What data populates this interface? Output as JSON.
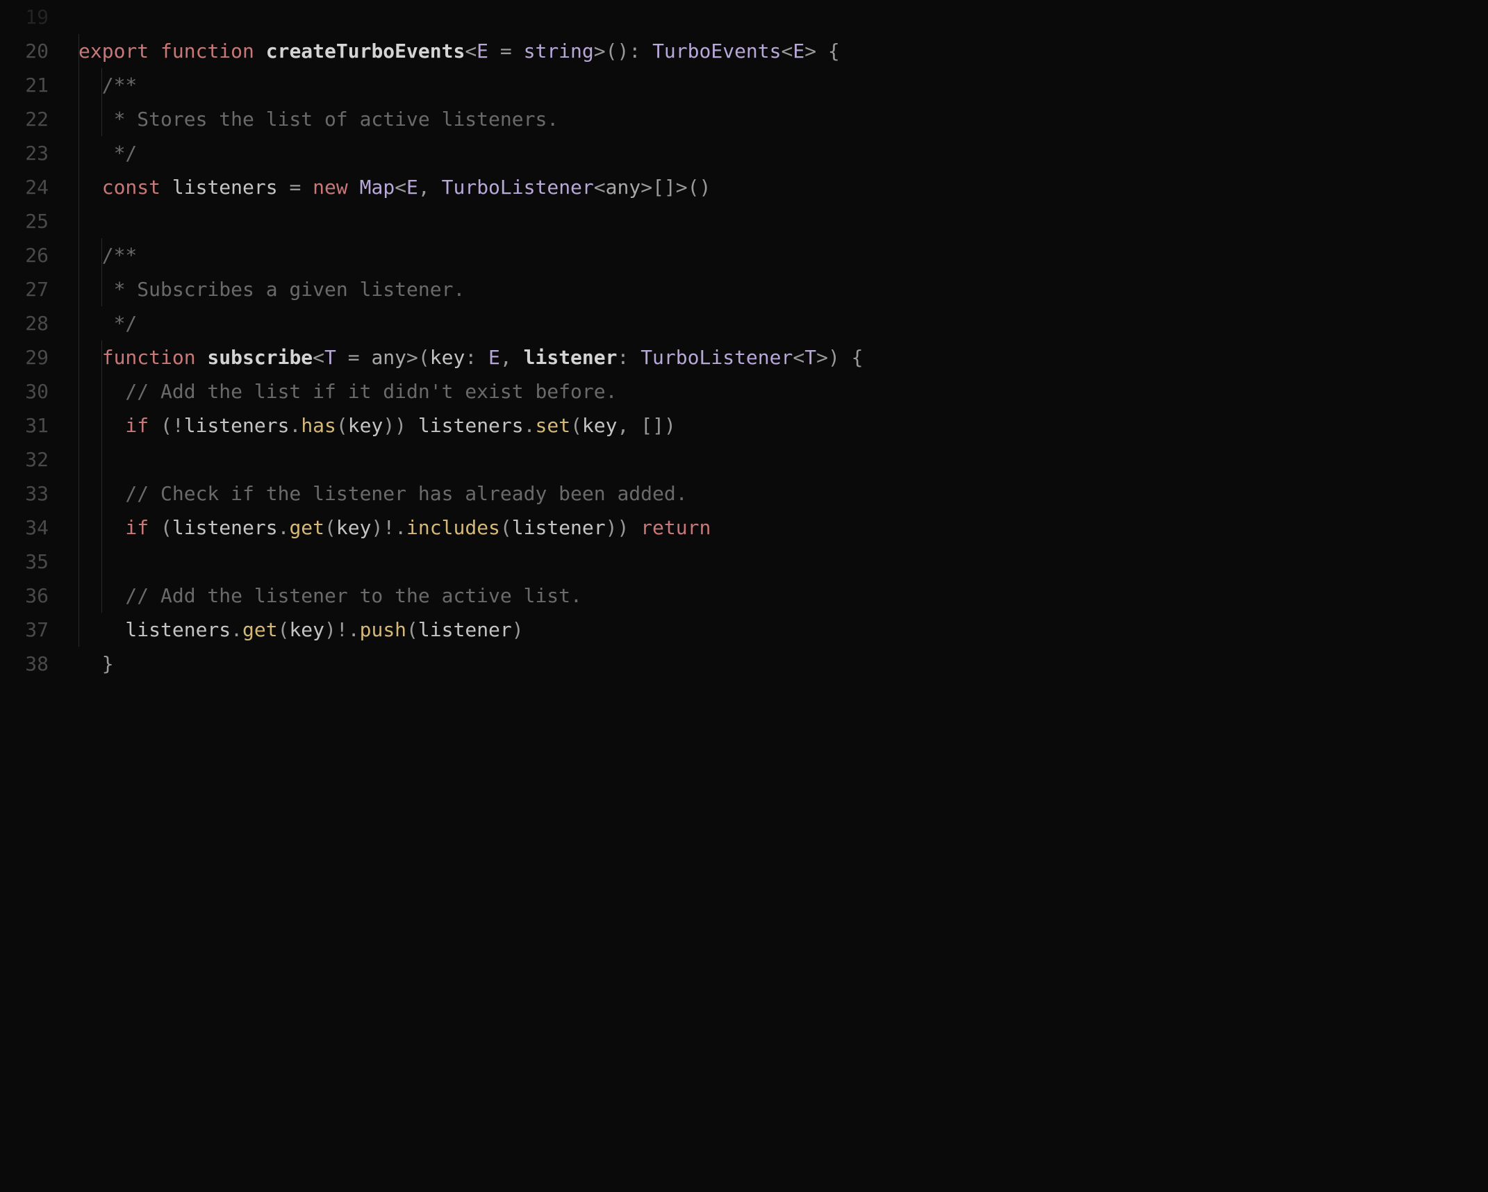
{
  "lineNumbers": [
    "19",
    "20",
    "21",
    "22",
    "23",
    "24",
    "25",
    "26",
    "27",
    "28",
    "29",
    "30",
    "31",
    "32",
    "33",
    "34",
    "35",
    "36",
    "37",
    "38"
  ],
  "code": {
    "l20": {
      "export": "export",
      "function": "function",
      "name": "createTurboEvents",
      "lt1": "<",
      "generic": "E",
      "eq": " = ",
      "string": "string",
      "gt1": ">",
      "parens": "()",
      "colon": ": ",
      "returnType": "TurboEvents",
      "lt2": "<",
      "generic2": "E",
      "gt2": ">",
      "brace": " {"
    },
    "l21": {
      "text": "  /**"
    },
    "l22": {
      "text": "   * Stores the list of active listeners."
    },
    "l23": {
      "text": "   */"
    },
    "l24": {
      "const": "  const",
      "name": " listeners",
      "eq": " = ",
      "new": "new",
      "map": " Map",
      "lt": "<",
      "e": "E",
      "comma": ", ",
      "type": "TurboListener",
      "lt2": "<",
      "any": "any",
      "gt2": ">",
      "arr": "[]",
      "gt": ">",
      "parens": "()"
    },
    "l26": {
      "text": "  /**"
    },
    "l27": {
      "text": "   * Subscribes a given listener."
    },
    "l28": {
      "text": "   */"
    },
    "l29": {
      "function": "  function",
      "name": " subscribe",
      "lt": "<",
      "t": "T",
      "eq": " = ",
      "any": "any",
      "gt": ">",
      "lparen": "(",
      "key": "key",
      "colon1": ": ",
      "e": "E",
      "comma": ", ",
      "listener": "listener",
      "colon2": ": ",
      "type": "TurboListener",
      "lt2": "<",
      "t2": "T",
      "gt2": ">",
      "rparen": ")",
      "brace": " {"
    },
    "l30": {
      "text": "    // Add the list if it didn't exist before."
    },
    "l31": {
      "if": "    if",
      "lparen": " (",
      "not": "!",
      "listeners": "listeners",
      "dot1": ".",
      "has": "has",
      "lp1": "(",
      "key1": "key",
      "rp1": "))",
      "space": " ",
      "listeners2": "listeners",
      "dot2": ".",
      "set": "set",
      "lp2": "(",
      "key2": "key",
      "comma": ", ",
      "arr": "[]",
      "rp2": ")"
    },
    "l33": {
      "text": "    // Check if the listener has already been added."
    },
    "l34": {
      "if": "    if",
      "lparen": " (",
      "listeners": "listeners",
      "dot1": ".",
      "get": "get",
      "lp1": "(",
      "key": "key",
      "rp1": ")",
      "bang": "!",
      "dot2": ".",
      "includes": "includes",
      "lp2": "(",
      "listener": "listener",
      "rp2": "))",
      "space": " ",
      "return": "return"
    },
    "l36": {
      "text": "    // Add the listener to the active list."
    },
    "l37": {
      "listeners": "    listeners",
      "dot1": ".",
      "get": "get",
      "lp1": "(",
      "key": "key",
      "rp1": ")",
      "bang": "!",
      "dot2": ".",
      "push": "push",
      "lp2": "(",
      "listener": "listener",
      "rp2": ")"
    },
    "l38": {
      "text": "  }"
    }
  }
}
